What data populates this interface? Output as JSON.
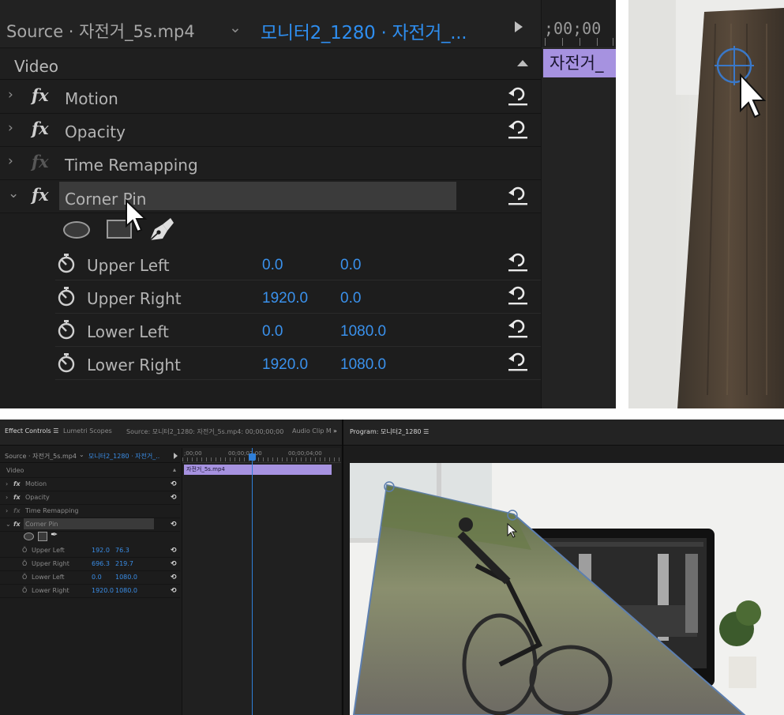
{
  "top_effect_controls": {
    "source_label": "Source · 자전거_5s.mp4",
    "sequence_label": "모니터2_1280 · 자전거_...",
    "timecode": ";00;00",
    "clip_label": "자전거_",
    "video_section": "Video",
    "effects": [
      {
        "name": "Motion",
        "expanded": false,
        "enabled": true
      },
      {
        "name": "Opacity",
        "expanded": false,
        "enabled": true
      },
      {
        "name": "Time Remapping",
        "expanded": false,
        "enabled": false
      },
      {
        "name": "Corner Pin",
        "expanded": true,
        "enabled": true,
        "selected": true
      }
    ],
    "mask_tools": [
      "ellipse-mask-icon",
      "rectangle-mask-icon",
      "pen-mask-icon"
    ],
    "corner_pin_params": [
      {
        "name": "Upper Left",
        "x": "0.0",
        "y": "0.0"
      },
      {
        "name": "Upper Right",
        "x": "1920.0",
        "y": "0.0"
      },
      {
        "name": "Lower Left",
        "x": "0.0",
        "y": "1080.0"
      },
      {
        "name": "Lower Right",
        "x": "1920.0",
        "y": "1080.0"
      }
    ]
  },
  "bottom_screenshot": {
    "tabs": {
      "effect_controls": "Effect Controls ☰",
      "lumetri_scopes": "Lumetri Scopes",
      "source": "Source: 모니터2_1280: 자전거_5s.mp4: 00;00;00;00",
      "audio_clip_mixer": "Audio Clip Mix",
      "overflow": "»",
      "program": "Program: 모니터2_1280 ☰"
    },
    "source_label": "Source · 자전거_5s.mp4",
    "sequence_label": "모니터2_1280 · 자전거_..",
    "timecodes": [
      ";00;00",
      "00;00;02;00",
      "00;00;04;00"
    ],
    "clip_label": "자전거_5s.mp4",
    "video_section": "Video",
    "effects": [
      "Motion",
      "Opacity",
      "Time Remapping",
      "Corner Pin"
    ],
    "corner_pin_params": [
      {
        "name": "Upper Left",
        "x": "192.0",
        "y": "76.3"
      },
      {
        "name": "Upper Right",
        "x": "696.3",
        "y": "219.7"
      },
      {
        "name": "Lower Left",
        "x": "0.0",
        "y": "1080.0"
      },
      {
        "name": "Lower Right",
        "x": "1920.0",
        "y": "1080.0"
      }
    ]
  },
  "colors": {
    "panel_bg": "#1d1d1d",
    "value_blue": "#3a91ec",
    "sequence_blue": "#2e8ef0",
    "clip_purple": "#a692e0",
    "selection_bg": "#3b3b3b"
  }
}
